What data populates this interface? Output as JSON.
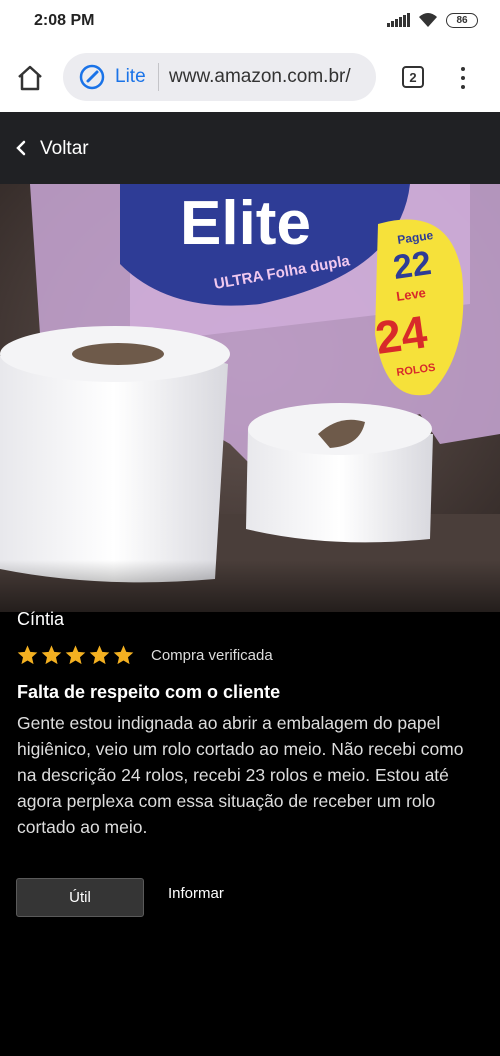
{
  "status_bar": {
    "time": "2:08 PM",
    "battery": "86"
  },
  "browser": {
    "lite_label": "Lite",
    "url": "www.amazon.com.br/",
    "tab_count": "2"
  },
  "header": {
    "back_label": "Voltar"
  },
  "photo": {
    "packaging_brand": "Elite",
    "packaging_subtitle": "ULTRA Folha dupla",
    "promo_pague": "Pague",
    "promo_22": "22",
    "promo_leve": "Leve",
    "promo_24": "24",
    "promo_rolos": "ROLOS"
  },
  "review": {
    "reviewer": "Cíntia",
    "rating": 5,
    "rating_max": 5,
    "verified_label": "Compra verificada",
    "title": "Falta de respeito com o cliente",
    "body": "Gente estou indignada ao abrir a embalagem do papel higiênico, veio um rolo cortado ao meio. Não recebi como na descrição 24 rolos, recebi 23 rolos e meio. Estou até agora perplexa com essa situação de receber um rolo cortado ao meio."
  },
  "actions": {
    "useful_label": "Útil",
    "report_label": "Informar"
  },
  "colors": {
    "star": "#f3b021",
    "lite_blue": "#1a73e8",
    "header_bg": "#202124"
  }
}
